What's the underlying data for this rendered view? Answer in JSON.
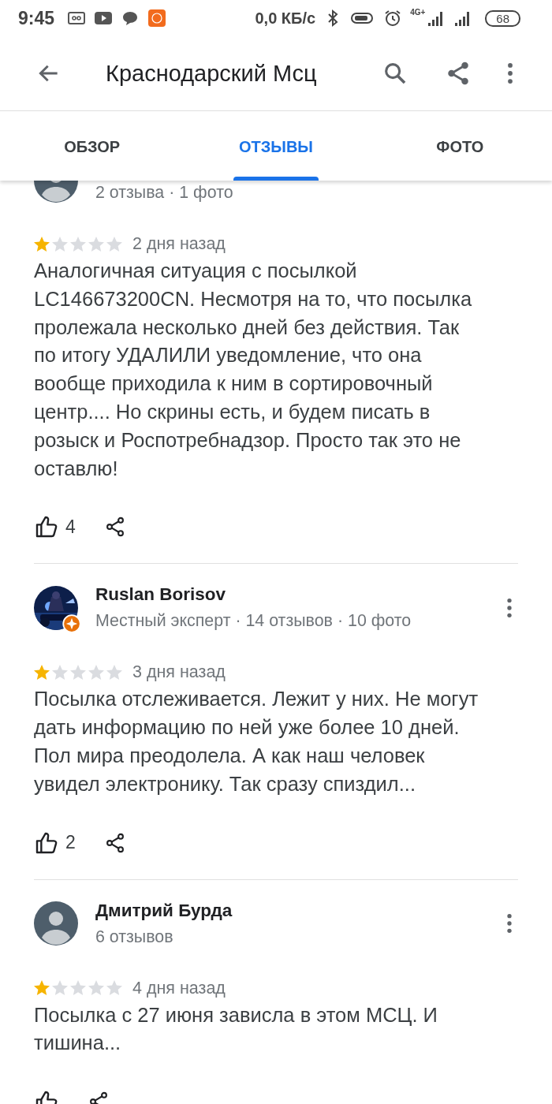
{
  "status_bar": {
    "time": "9:45",
    "network_speed": "0,0 КБ/с",
    "network_type": "4G+",
    "battery": "68"
  },
  "app_bar": {
    "title": "Краснодарский Мсц"
  },
  "tabs": [
    {
      "label": "ОБЗОР",
      "selected": false
    },
    {
      "label": "ОТЗЫВЫ",
      "selected": true
    },
    {
      "label": "ФОТО",
      "selected": false
    }
  ],
  "reviews": [
    {
      "avatar": {
        "kind": "placeholder"
      },
      "meta": "2 отзыва · 1 фото",
      "stars": 1,
      "date": "2 дня назад",
      "text": "Аналогичная ситуация с посылкой LC146673200CN. Несмотря на то, что посылка пролежала несколько дней без действия. Так по итогу УДАЛИЛИ уведомление, что она вообще приходила к ним в сортировочный центр.... Но скрины есть, и будем писать в розыск и Роспотребнадзор. Просто так это не оставлю!",
      "likes": "4"
    },
    {
      "local_guide": true,
      "name": "Ruslan Borisov",
      "meta": "Местный эксперт · 14 отзывов · 10 фото",
      "stars": 1,
      "date": "3 дня назад",
      "text": "Посылка отслеживается. Лежит у них. Не могут дать информацию по ней уже более 10 дней. Пол мира преодолела. А как наш человек увидел электронику. Так сразу спиздил...",
      "likes": "2"
    },
    {
      "avatar": {
        "kind": "placeholder"
      },
      "name": "Дмитрий Бурда",
      "meta": "6 отзывов",
      "stars": 1,
      "date": "4 дня назад",
      "text": "Посылка с 27 июня зависла в этом МСЦ. И тишина..."
    }
  ]
}
